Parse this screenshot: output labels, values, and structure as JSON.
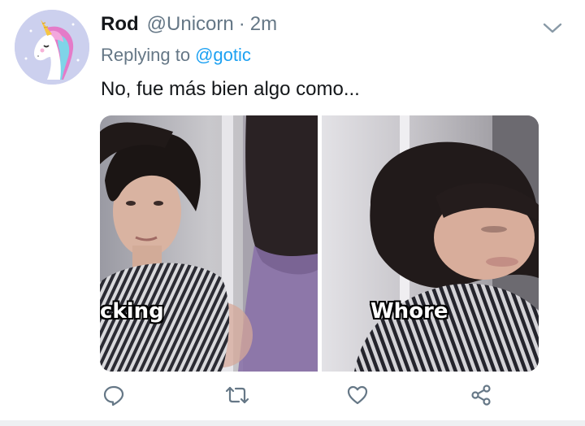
{
  "tweet": {
    "display_name": "Rod",
    "handle": "@Unicorn",
    "separator": "·",
    "time": "2m",
    "replying_prefix": "Replying to",
    "replying_to": "@gotic",
    "text": "No, fue más bien algo como..."
  },
  "media": {
    "left_caption": "cking",
    "right_caption": "Whore"
  },
  "icons": {
    "avatar": "unicorn-avatar",
    "caret": "chevron-down-icon",
    "reply": "reply-icon",
    "retweet": "retweet-icon",
    "like": "heart-icon",
    "share": "share-icon"
  },
  "colors": {
    "link": "#1da1f2",
    "secondary_text": "#657786",
    "primary_text": "#14171a",
    "icon": "#657786"
  }
}
